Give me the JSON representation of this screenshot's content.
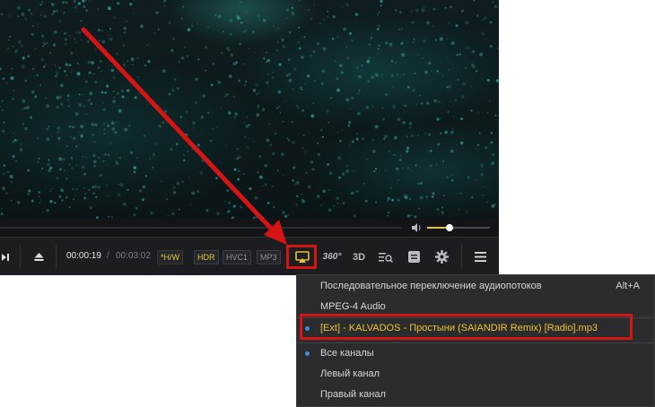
{
  "player": {
    "time_current": "00:00:19",
    "time_separator": "/",
    "time_total": "00:03:02",
    "badges": [
      "*H/W",
      "HDR",
      "HVC1",
      "MP3"
    ],
    "volume_level": 0.35,
    "icons": {
      "next": "skip-next-icon",
      "eject": "eject-icon",
      "airplay": "airplay-icon",
      "vr360": "360-icon",
      "three_d": "3d-icon",
      "playlist_search": "playlist-search-icon",
      "subtitles": "subtitles-icon",
      "settings": "gear-icon",
      "menu": "hamburger-menu-icon",
      "volume": "speaker-icon"
    },
    "label_360": "360°",
    "label_3d": "3D"
  },
  "menu": {
    "items": [
      {
        "label": "Последовательное переключение аудиопотоков",
        "shortcut": "Alt+A"
      },
      {
        "label": "MPEG-4 Audio"
      },
      {
        "label": "[Ext] - KALVADOS - Простыни (SAIANDIR Remix) [Radio].mp3",
        "checked": true,
        "highlighted": true
      },
      {
        "label": "Все каналы",
        "checked": true
      },
      {
        "label": "Левый канал"
      },
      {
        "label": "Правый канал"
      }
    ]
  },
  "colors": {
    "accent": "#e9c63a",
    "annotation": "#d51414",
    "check_dot": "#3d8fe0"
  }
}
